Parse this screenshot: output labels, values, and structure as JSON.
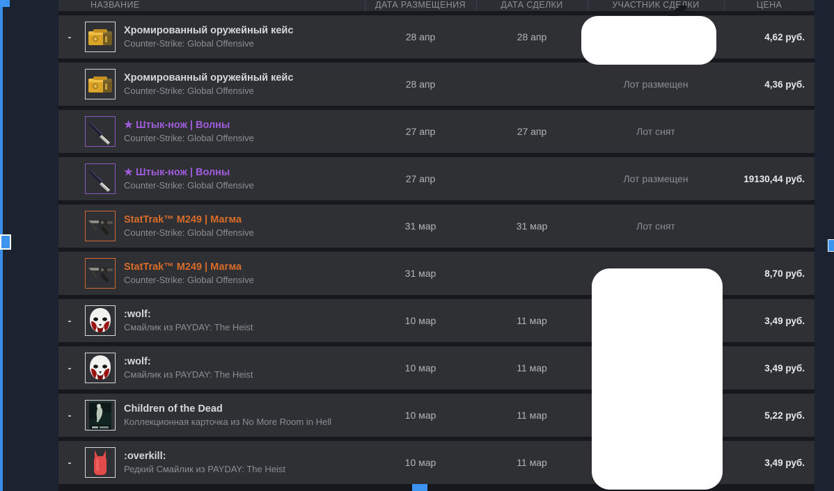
{
  "table": {
    "columns": {
      "name": "НАЗВАНИЕ",
      "listed_date": "ДАТА РАЗМЕЩЕНИЯ",
      "deal_date": "ДАТА СДЕЛКИ",
      "party": "УЧАСТНИК СДЕЛКИ",
      "price": "ЦЕНА"
    },
    "rows": [
      {
        "dash": "-",
        "icon": "weapon-case-icon",
        "title": "Хромированный оружейный кейс",
        "subtitle": "Counter-Strike: Global Offensive",
        "rarity": "default",
        "listed_date": "28 апр",
        "deal_date": "28 апр",
        "party": "",
        "price": "4,62 руб."
      },
      {
        "dash": "",
        "icon": "weapon-case-icon",
        "title": "Хромированный оружейный кейс",
        "subtitle": "Counter-Strike: Global Offensive",
        "rarity": "default",
        "listed_date": "28 апр",
        "deal_date": "",
        "party": "Лот размещен",
        "price": "4,36 руб."
      },
      {
        "dash": "",
        "icon": "bayonet-knife-icon",
        "title": "★ Штык-нож | Волны",
        "subtitle": "Counter-Strike: Global Offensive",
        "rarity": "purple",
        "listed_date": "27 апр",
        "deal_date": "27 апр",
        "party": "Лот снят",
        "price": ""
      },
      {
        "dash": "",
        "icon": "bayonet-knife-icon",
        "title": "★ Штык-нож | Волны",
        "subtitle": "Counter-Strike: Global Offensive",
        "rarity": "purple",
        "listed_date": "27 апр",
        "deal_date": "",
        "party": "Лот размещен",
        "price": "19130,44 руб."
      },
      {
        "dash": "",
        "icon": "machinegun-icon",
        "title": "StatTrak™ M249 | Магма",
        "subtitle": "Counter-Strike: Global Offensive",
        "rarity": "orange",
        "listed_date": "31 мар",
        "deal_date": "31 мар",
        "party": "Лот снят",
        "price": ""
      },
      {
        "dash": "",
        "icon": "machinegun-icon",
        "title": "StatTrak™ M249 | Магма",
        "subtitle": "Counter-Strike: Global Offensive",
        "rarity": "orange",
        "listed_date": "31 мар",
        "deal_date": "",
        "party": "",
        "price": "8,70 руб."
      },
      {
        "dash": "-",
        "icon": "wolf-mask-icon",
        "title": ":wolf:",
        "subtitle": "Смайлик из PAYDAY: The Heist",
        "rarity": "default",
        "listed_date": "10 мар",
        "deal_date": "11 мар",
        "party": "",
        "price": "3,49 руб."
      },
      {
        "dash": "-",
        "icon": "wolf-mask-icon",
        "title": ":wolf:",
        "subtitle": "Смайлик из PAYDAY: The Heist",
        "rarity": "default",
        "listed_date": "10 мар",
        "deal_date": "11 мар",
        "party": "",
        "price": "3,49 руб."
      },
      {
        "dash": "-",
        "icon": "trading-card-icon",
        "title": "Children of the Dead",
        "subtitle": "Коллекционная карточка из No More Room in Hell",
        "rarity": "default",
        "listed_date": "10 мар",
        "deal_date": "11 мар",
        "party": "",
        "price": "5,22 руб."
      },
      {
        "dash": "-",
        "icon": "overkill-bomb-icon",
        "title": ":overkill:",
        "subtitle": "Редкий Смайлик из PAYDAY: The Heist",
        "rarity": "default",
        "listed_date": "10 мар",
        "deal_date": "11 мар",
        "party": "",
        "price": "3,49 руб."
      }
    ]
  },
  "colors": {
    "page_background": "#1b2331",
    "panel_background": "#16181d",
    "row_background": "#2e3034",
    "header_background": "#2b2e33",
    "rarity_purple": "#a05ddb",
    "rarity_orange": "#d96b2a",
    "accent_blue": "#3d93f0",
    "mask_white": "#ffffff"
  }
}
